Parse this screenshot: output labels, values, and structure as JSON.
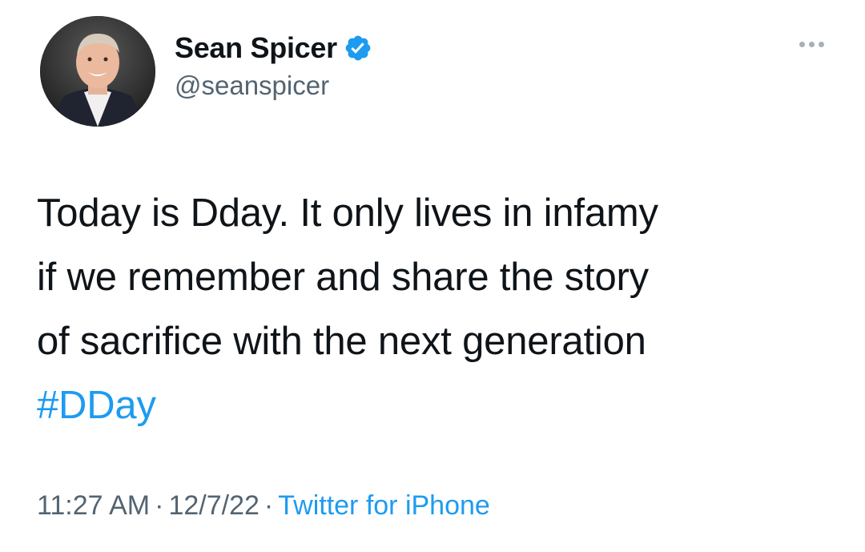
{
  "tweet": {
    "author": {
      "display_name": "Sean Spicer",
      "handle": "@seanspicer",
      "verified": true,
      "avatar_icon": "profile-photo",
      "verified_icon": "verified-badge-icon",
      "verified_color": "#1d9bf0"
    },
    "more_icon": "more-options-icon",
    "text_lines": [
      "Today is Dday.  It only lives in infamy",
      "if we remember and share the story",
      "of sacrifice with the next generation"
    ],
    "hashtag": "#DDay",
    "time": "11:27 AM",
    "separator": "·",
    "date": "12/7/22",
    "source": "Twitter for iPhone",
    "colors": {
      "text": "#0f1419",
      "secondary": "#536471",
      "link": "#1d9bf0",
      "background": "#ffffff"
    }
  }
}
